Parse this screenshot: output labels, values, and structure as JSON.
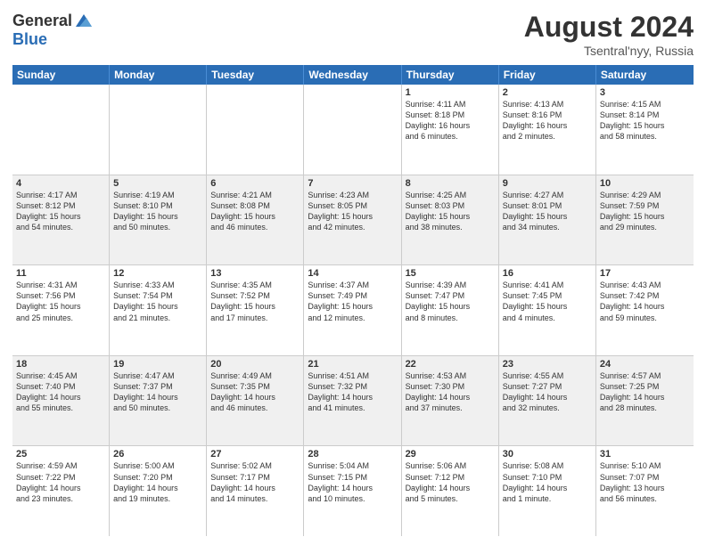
{
  "logo": {
    "general": "General",
    "blue": "Blue"
  },
  "title": "August 2024",
  "subtitle": "Tsentral'nyy, Russia",
  "days": [
    "Sunday",
    "Monday",
    "Tuesday",
    "Wednesday",
    "Thursday",
    "Friday",
    "Saturday"
  ],
  "weeks": [
    [
      {
        "day": "",
        "text": ""
      },
      {
        "day": "",
        "text": ""
      },
      {
        "day": "",
        "text": ""
      },
      {
        "day": "",
        "text": ""
      },
      {
        "day": "1",
        "text": "Sunrise: 4:11 AM\nSunset: 8:18 PM\nDaylight: 16 hours\nand 6 minutes."
      },
      {
        "day": "2",
        "text": "Sunrise: 4:13 AM\nSunset: 8:16 PM\nDaylight: 16 hours\nand 2 minutes."
      },
      {
        "day": "3",
        "text": "Sunrise: 4:15 AM\nSunset: 8:14 PM\nDaylight: 15 hours\nand 58 minutes."
      }
    ],
    [
      {
        "day": "4",
        "text": "Sunrise: 4:17 AM\nSunset: 8:12 PM\nDaylight: 15 hours\nand 54 minutes."
      },
      {
        "day": "5",
        "text": "Sunrise: 4:19 AM\nSunset: 8:10 PM\nDaylight: 15 hours\nand 50 minutes."
      },
      {
        "day": "6",
        "text": "Sunrise: 4:21 AM\nSunset: 8:08 PM\nDaylight: 15 hours\nand 46 minutes."
      },
      {
        "day": "7",
        "text": "Sunrise: 4:23 AM\nSunset: 8:05 PM\nDaylight: 15 hours\nand 42 minutes."
      },
      {
        "day": "8",
        "text": "Sunrise: 4:25 AM\nSunset: 8:03 PM\nDaylight: 15 hours\nand 38 minutes."
      },
      {
        "day": "9",
        "text": "Sunrise: 4:27 AM\nSunset: 8:01 PM\nDaylight: 15 hours\nand 34 minutes."
      },
      {
        "day": "10",
        "text": "Sunrise: 4:29 AM\nSunset: 7:59 PM\nDaylight: 15 hours\nand 29 minutes."
      }
    ],
    [
      {
        "day": "11",
        "text": "Sunrise: 4:31 AM\nSunset: 7:56 PM\nDaylight: 15 hours\nand 25 minutes."
      },
      {
        "day": "12",
        "text": "Sunrise: 4:33 AM\nSunset: 7:54 PM\nDaylight: 15 hours\nand 21 minutes."
      },
      {
        "day": "13",
        "text": "Sunrise: 4:35 AM\nSunset: 7:52 PM\nDaylight: 15 hours\nand 17 minutes."
      },
      {
        "day": "14",
        "text": "Sunrise: 4:37 AM\nSunset: 7:49 PM\nDaylight: 15 hours\nand 12 minutes."
      },
      {
        "day": "15",
        "text": "Sunrise: 4:39 AM\nSunset: 7:47 PM\nDaylight: 15 hours\nand 8 minutes."
      },
      {
        "day": "16",
        "text": "Sunrise: 4:41 AM\nSunset: 7:45 PM\nDaylight: 15 hours\nand 4 minutes."
      },
      {
        "day": "17",
        "text": "Sunrise: 4:43 AM\nSunset: 7:42 PM\nDaylight: 14 hours\nand 59 minutes."
      }
    ],
    [
      {
        "day": "18",
        "text": "Sunrise: 4:45 AM\nSunset: 7:40 PM\nDaylight: 14 hours\nand 55 minutes."
      },
      {
        "day": "19",
        "text": "Sunrise: 4:47 AM\nSunset: 7:37 PM\nDaylight: 14 hours\nand 50 minutes."
      },
      {
        "day": "20",
        "text": "Sunrise: 4:49 AM\nSunset: 7:35 PM\nDaylight: 14 hours\nand 46 minutes."
      },
      {
        "day": "21",
        "text": "Sunrise: 4:51 AM\nSunset: 7:32 PM\nDaylight: 14 hours\nand 41 minutes."
      },
      {
        "day": "22",
        "text": "Sunrise: 4:53 AM\nSunset: 7:30 PM\nDaylight: 14 hours\nand 37 minutes."
      },
      {
        "day": "23",
        "text": "Sunrise: 4:55 AM\nSunset: 7:27 PM\nDaylight: 14 hours\nand 32 minutes."
      },
      {
        "day": "24",
        "text": "Sunrise: 4:57 AM\nSunset: 7:25 PM\nDaylight: 14 hours\nand 28 minutes."
      }
    ],
    [
      {
        "day": "25",
        "text": "Sunrise: 4:59 AM\nSunset: 7:22 PM\nDaylight: 14 hours\nand 23 minutes."
      },
      {
        "day": "26",
        "text": "Sunrise: 5:00 AM\nSunset: 7:20 PM\nDaylight: 14 hours\nand 19 minutes."
      },
      {
        "day": "27",
        "text": "Sunrise: 5:02 AM\nSunset: 7:17 PM\nDaylight: 14 hours\nand 14 minutes."
      },
      {
        "day": "28",
        "text": "Sunrise: 5:04 AM\nSunset: 7:15 PM\nDaylight: 14 hours\nand 10 minutes."
      },
      {
        "day": "29",
        "text": "Sunrise: 5:06 AM\nSunset: 7:12 PM\nDaylight: 14 hours\nand 5 minutes."
      },
      {
        "day": "30",
        "text": "Sunrise: 5:08 AM\nSunset: 7:10 PM\nDaylight: 14 hours\nand 1 minute."
      },
      {
        "day": "31",
        "text": "Sunrise: 5:10 AM\nSunset: 7:07 PM\nDaylight: 13 hours\nand 56 minutes."
      }
    ]
  ]
}
